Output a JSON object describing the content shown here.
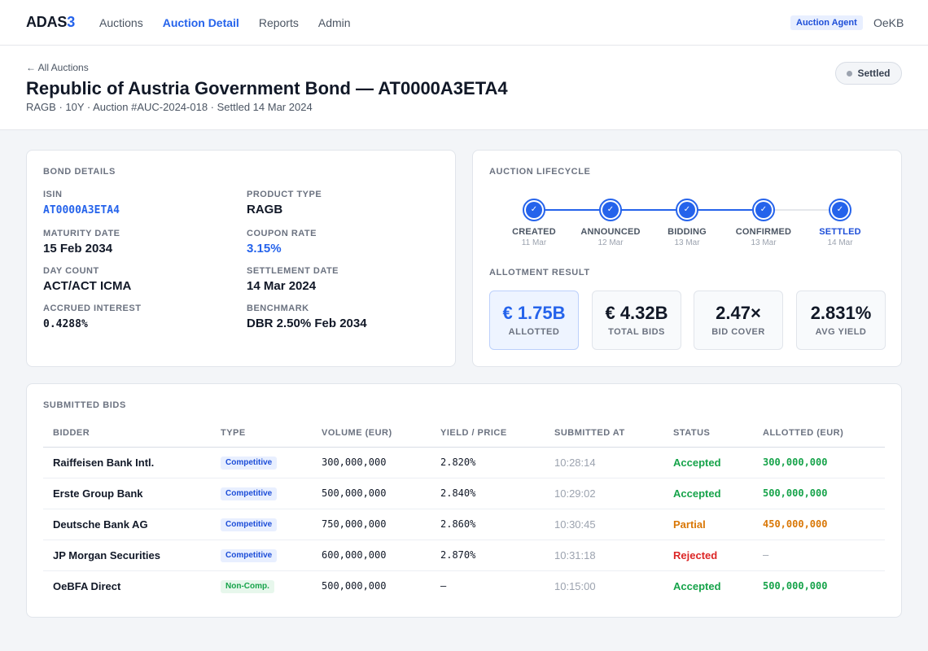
{
  "app": {
    "logo_main": "ADAS",
    "logo_accent": "3"
  },
  "nav": {
    "items": [
      {
        "label": "Auctions",
        "active": false
      },
      {
        "label": "Auction Detail",
        "active": true
      },
      {
        "label": "Reports",
        "active": false
      },
      {
        "label": "Admin",
        "active": false
      }
    ],
    "role_badge": "Auction Agent",
    "user": "OeKB"
  },
  "header": {
    "back_arrow": "←",
    "back_label": "All Auctions",
    "title": "Republic of Austria Government Bond — AT0000A3ETA4",
    "subtitle": "RAGB · 10Y · Auction #AUC-2024-018 · Settled 14 Mar 2024",
    "status": "Settled"
  },
  "bond": {
    "title": "BOND DETAILS",
    "isin": {
      "label": "ISIN",
      "value": "AT0000A3ETA4"
    },
    "product_type": {
      "label": "PRODUCT TYPE",
      "value": "RAGB"
    },
    "maturity": {
      "label": "MATURITY DATE",
      "value": "15 Feb 2034"
    },
    "coupon": {
      "label": "COUPON RATE",
      "value": "3.15%"
    },
    "day_count": {
      "label": "DAY COUNT",
      "value": "ACT/ACT ICMA"
    },
    "settlement": {
      "label": "SETTLEMENT DATE",
      "value": "14 Mar 2024"
    },
    "accrued": {
      "label": "ACCRUED INTEREST",
      "value": "0.4288%"
    },
    "benchmark": {
      "label": "BENCHMARK",
      "value": "DBR 2.50% Feb 2034"
    }
  },
  "lifecycle": {
    "title": "AUCTION LIFECYCLE",
    "check_glyph": "✓",
    "steps": [
      {
        "name": "CREATED",
        "date": "11 Mar"
      },
      {
        "name": "ANNOUNCED",
        "date": "12 Mar"
      },
      {
        "name": "BIDDING",
        "date": "13 Mar"
      },
      {
        "name": "CONFIRMED",
        "date": "13 Mar"
      },
      {
        "name": "SETTLED",
        "date": "14 Mar"
      }
    ]
  },
  "allotment": {
    "title": "ALLOTMENT RESULT",
    "stats": [
      {
        "value": "€ 1.75B",
        "label": "ALLOTTED"
      },
      {
        "value": "€ 4.32B",
        "label": "TOTAL BIDS"
      },
      {
        "value": "2.47×",
        "label": "BID COVER"
      },
      {
        "value": "2.831%",
        "label": "AVG YIELD"
      }
    ]
  },
  "bids": {
    "title": "SUBMITTED BIDS",
    "columns": [
      "BIDDER",
      "TYPE",
      "VOLUME (EUR)",
      "YIELD / PRICE",
      "SUBMITTED AT",
      "STATUS",
      "ALLOTTED (EUR)"
    ],
    "rows": [
      {
        "bidder": "Raiffeisen Bank Intl.",
        "type": "Competitive",
        "volume": "300,000,000",
        "yield": "2.820%",
        "time": "10:28:14",
        "status": "Accepted",
        "allotted": "300,000,000"
      },
      {
        "bidder": "Erste Group Bank",
        "type": "Competitive",
        "volume": "500,000,000",
        "yield": "2.840%",
        "time": "10:29:02",
        "status": "Accepted",
        "allotted": "500,000,000"
      },
      {
        "bidder": "Deutsche Bank AG",
        "type": "Competitive",
        "volume": "750,000,000",
        "yield": "2.860%",
        "time": "10:30:45",
        "status": "Partial",
        "allotted": "450,000,000"
      },
      {
        "bidder": "JP Morgan Securities",
        "type": "Competitive",
        "volume": "600,000,000",
        "yield": "2.870%",
        "time": "10:31:18",
        "status": "Rejected",
        "allotted": "–"
      },
      {
        "bidder": "OeBFA Direct",
        "type": "Non-Comp.",
        "volume": "500,000,000",
        "yield": "–",
        "time": "10:15:00",
        "status": "Accepted",
        "allotted": "500,000,000"
      }
    ]
  },
  "colors": {
    "accent": "#2563eb",
    "accepted": "#16a34a",
    "partial": "#d97706",
    "rejected": "#dc2626",
    "competitive_bg": "#e8efff",
    "competitive_fg": "#1d4ed8",
    "noncomp_bg": "#e7f7ec",
    "noncomp_fg": "#16a34a"
  }
}
